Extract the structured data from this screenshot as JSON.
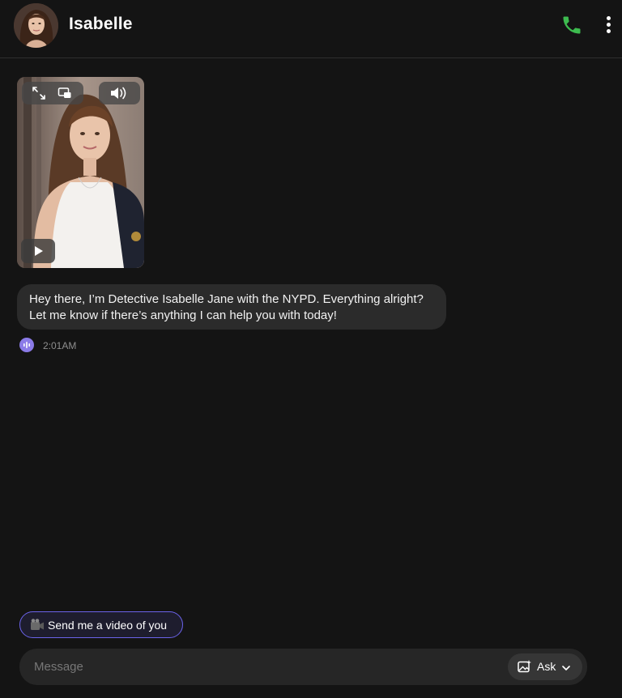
{
  "header": {
    "contact_name": "Isabelle",
    "icons": {
      "call": "phone-icon",
      "more": "more-vertical-icon"
    }
  },
  "video": {
    "icons": {
      "expand": "expand-icon",
      "pip": "picture-in-picture-icon",
      "volume": "volume-icon",
      "play": "play-icon"
    }
  },
  "messages": [
    {
      "lines": [
        "Hey there, I’m Detective Isabelle Jane with the NYPD. Everything alright?",
        "Let me know if there’s anything I can help you with today!"
      ],
      "time": "2:01AM",
      "icon": "audio-wave-icon"
    }
  ],
  "suggestion": {
    "emoji": "🎥",
    "label": "Send me a video of you"
  },
  "composer": {
    "placeholder": "Message",
    "ask_label": "Ask",
    "icons": {
      "ask": "image-sparkle-icon",
      "chevron": "chevron-down-icon"
    }
  },
  "colors": {
    "background": "#141414",
    "bubble": "#2b2b2b",
    "call_green": "#3dbb4f",
    "accent_purple": "#6b63ea",
    "audio_icon": "#8b7be8"
  }
}
